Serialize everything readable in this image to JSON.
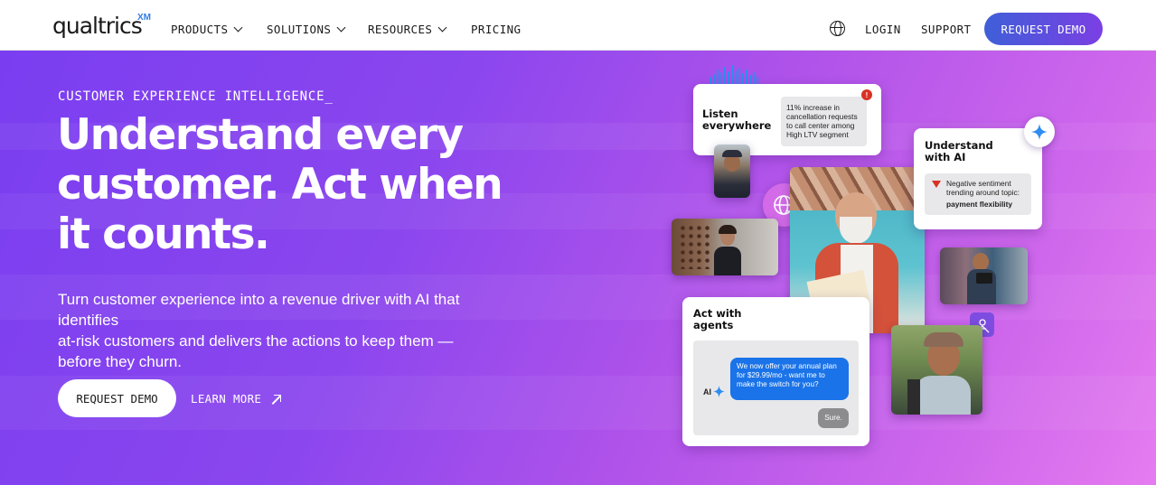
{
  "nav": {
    "logo": "qualtrics",
    "logo_mark": "XM",
    "links": [
      "PRODUCTS",
      "SOLUTIONS",
      "RESOURCES",
      "PRICING"
    ],
    "login": "LOGIN",
    "support": "SUPPORT",
    "request_demo": "REQUEST DEMO"
  },
  "hero": {
    "eyebrow": "CUSTOMER EXPERIENCE INTELLIGENCE_",
    "headline_lines": [
      "Understand every",
      "customer. Act when",
      "it counts."
    ],
    "subtext_lines": [
      "Turn customer experience into a revenue driver with AI that identifies",
      "at-risk customers and delivers the actions to keep them —",
      "before they churn."
    ],
    "primary_cta": "REQUEST DEMO",
    "secondary_cta": "LEARN MORE"
  },
  "cards": {
    "listen": {
      "title_lines": [
        "Listen",
        "everywhere"
      ],
      "alert_lines": [
        "11% increase in",
        "cancellation requests",
        "to call center among",
        "High LTV segment"
      ]
    },
    "understand": {
      "title_lines": [
        "Understand",
        "with AI"
      ],
      "insight_lines": [
        "Negative sentiment",
        "trending around topic:"
      ],
      "insight_topic": "payment flexibility"
    },
    "act": {
      "title_lines": [
        "Act with",
        "agents"
      ],
      "ai_label": "AI",
      "bot_message_lines": [
        "We now offer your annual plan",
        "for $29.99/mo - want me to",
        "make the switch for you?"
      ],
      "user_reply": "Sure."
    }
  },
  "colors": {
    "hero_gradient_start": "#7a3ef0",
    "hero_gradient_end": "#e57cf0",
    "demo_button_start": "#3f5fd8",
    "demo_button_end": "#7b3fe4",
    "chat_bubble": "#1a73e8",
    "alert_red": "#d93025"
  },
  "icons": [
    "globe-icon",
    "chevron-down-icon",
    "arrow-up-right-icon",
    "soundwave-icon",
    "alert-icon",
    "sparkle-icon",
    "network-globe-icon",
    "triangle-down-icon",
    "agent-icon"
  ]
}
